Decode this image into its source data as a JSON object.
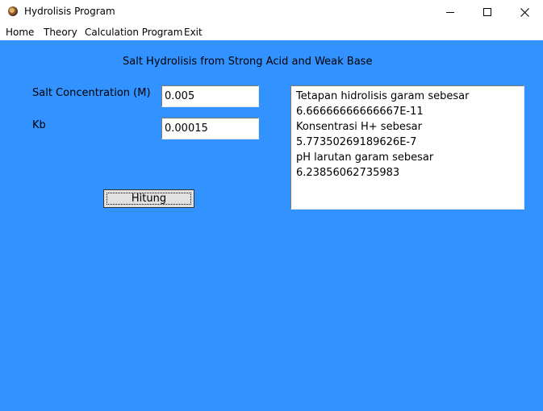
{
  "window": {
    "title": "Hydrolisis Program"
  },
  "menu": {
    "items": [
      "Home",
      "Theory",
      "Calculation Program",
      "Exit"
    ]
  },
  "form": {
    "heading": "Salt Hydrolisis from Strong Acid and Weak Base",
    "salt_label": "Salt Concentration (M)",
    "salt_value": "0.005",
    "kb_label": "Kb",
    "kb_value": "0.00015",
    "button_label": "Hitung"
  },
  "output": {
    "lines": [
      "Tetapan hidrolisis garam sebesar",
      "6.66666666666667E-11",
      "Konsentrasi H+ sebesar",
      "5.77350269189626E-7",
      "pH larutan garam sebesar",
      "6.23856062735983"
    ]
  },
  "colors": {
    "client_background": "#3292ff",
    "window_chrome": "#ffffff"
  }
}
